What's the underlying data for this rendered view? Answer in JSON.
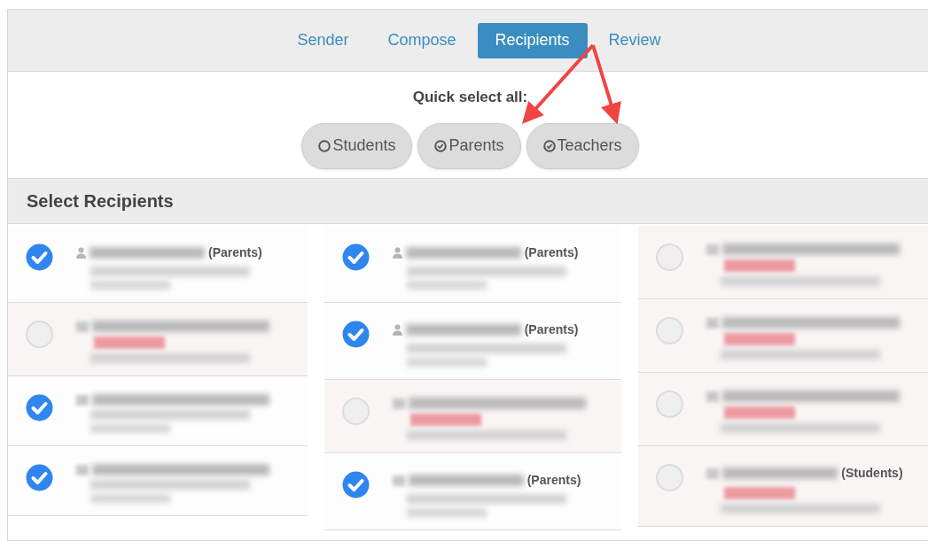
{
  "tabs": [
    {
      "label": "Sender",
      "selected": false
    },
    {
      "label": "Compose",
      "selected": false
    },
    {
      "label": "Recipients",
      "selected": true
    },
    {
      "label": "Review",
      "selected": false
    }
  ],
  "quick_select": {
    "title": "Quick select all:",
    "options": [
      {
        "label": "Students",
        "checked": false
      },
      {
        "label": "Parents",
        "checked": true
      },
      {
        "label": "Teachers",
        "checked": true
      }
    ]
  },
  "section_title": "Select Recipients",
  "columns": [
    [
      {
        "selected": true,
        "person_icon": true,
        "flagged": false,
        "tag": "(Parents)"
      },
      {
        "selected": false,
        "person_icon": false,
        "flagged": true
      },
      {
        "selected": true,
        "person_icon": false,
        "flagged": false
      },
      {
        "selected": true,
        "person_icon": false,
        "flagged": false
      }
    ],
    [
      {
        "selected": true,
        "person_icon": true,
        "flagged": false,
        "tag": "(Parents)"
      },
      {
        "selected": true,
        "person_icon": true,
        "flagged": false,
        "tag": "(Parents)"
      },
      {
        "selected": false,
        "person_icon": false,
        "flagged": true
      },
      {
        "selected": true,
        "person_icon": false,
        "flagged": false,
        "tag": "(Parents)"
      }
    ],
    [
      {
        "selected": false,
        "person_icon": false,
        "flagged": true
      },
      {
        "selected": false,
        "person_icon": false,
        "flagged": true
      },
      {
        "selected": false,
        "person_icon": false,
        "flagged": true
      },
      {
        "selected": false,
        "person_icon": false,
        "flagged": true,
        "tag": "(Students)"
      }
    ]
  ]
}
